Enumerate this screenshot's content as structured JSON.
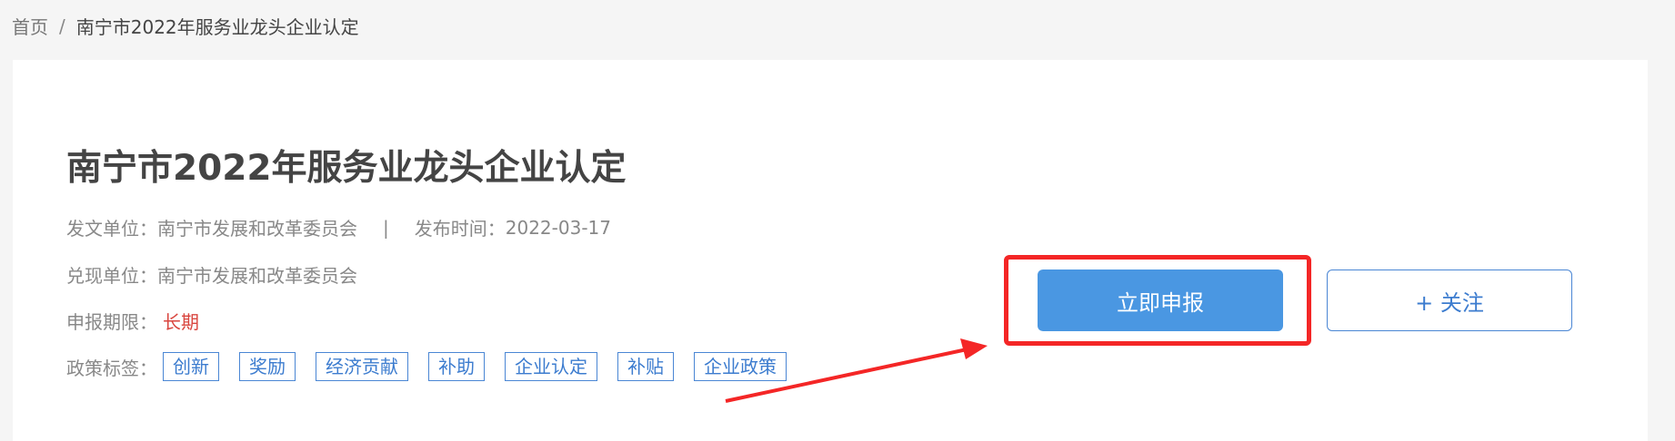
{
  "breadcrumb": {
    "home": "首页",
    "separator": "/",
    "current": "南宁市2022年服务业龙头企业认定"
  },
  "policy": {
    "title": "南宁市2022年服务业龙头企业认定",
    "issuer_label": "发文单位：",
    "issuer": "南宁市发展和改革委员会",
    "divider": "|",
    "publish_label": "发布时间：",
    "publish_date": "2022-03-17",
    "cash_label": "兑现单位：",
    "cash_unit": "南宁市发展和改革委员会",
    "deadline_label": "申报期限：",
    "deadline": "长期",
    "tags_label": "政策标签：",
    "tags": [
      "创新",
      "奖励",
      "经济贡献",
      "补助",
      "企业认定",
      "补贴",
      "企业政策"
    ]
  },
  "actions": {
    "apply_label": "立即申报",
    "follow_label": "+ 关注"
  },
  "colors": {
    "primary": "#4a97e2",
    "annotation_red": "#f42626",
    "deadline_red": "#d9463f"
  }
}
